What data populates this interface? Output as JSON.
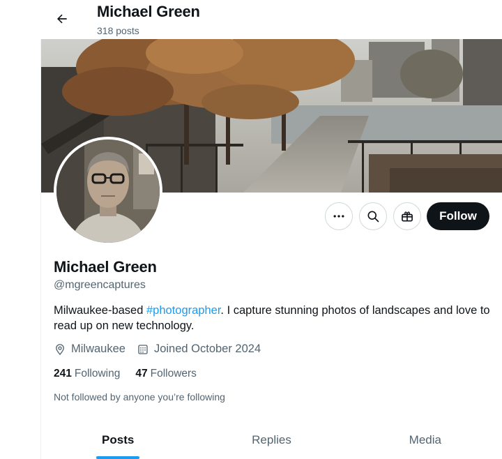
{
  "header": {
    "title": "Michael Green",
    "post_count": "318 posts"
  },
  "profile": {
    "display_name": "Michael Green",
    "handle": "@mgreencaptures",
    "bio_before": "Milwaukee-based ",
    "bio_hashtag": "#photographer",
    "bio_after": ". I capture stunning photos of landscapes and love to read up on new technology.",
    "location": "Milwaukee",
    "joined": "Joined October 2024",
    "following_count": "241",
    "following_label": "Following",
    "followers_count": "47",
    "followers_label": "Followers",
    "not_followed_text": "Not followed by anyone you’re following"
  },
  "actions": {
    "follow_label": "Follow"
  },
  "tabs": [
    {
      "label": "Posts",
      "active": true
    },
    {
      "label": "Replies",
      "active": false
    },
    {
      "label": "Media",
      "active": false
    }
  ],
  "icons": {
    "back": "arrow-left-icon",
    "more": "more-dots-icon",
    "search": "search-icon",
    "subscribe": "gift-icon",
    "location": "location-pin-icon",
    "calendar": "calendar-icon"
  },
  "colors": {
    "accent": "#1d9bf0",
    "text_primary": "#0f1419",
    "text_secondary": "#536471",
    "follow_button_bg": "#0f1419"
  }
}
